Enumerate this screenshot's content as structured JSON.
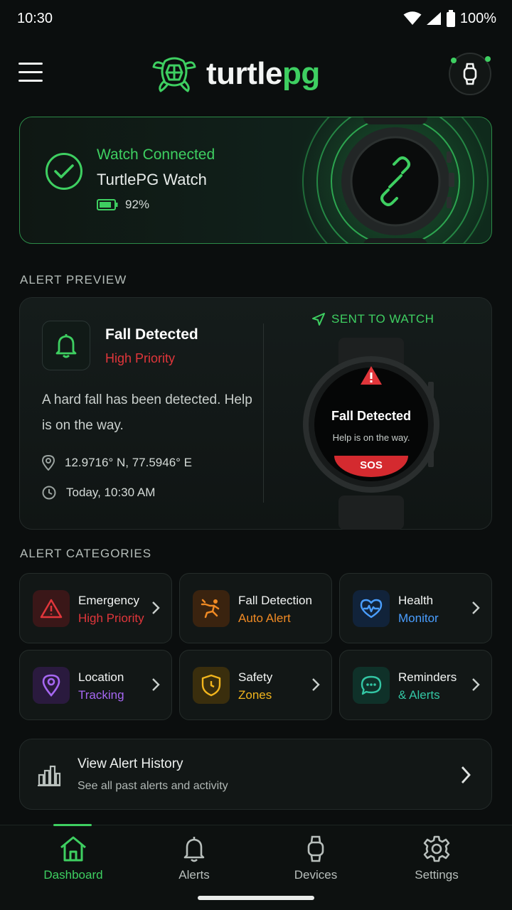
{
  "status_bar": {
    "time": "10:30",
    "battery": "100%"
  },
  "header": {
    "brand_part1": "turtle",
    "brand_part2": "pg"
  },
  "watch_connection": {
    "status": "Watch Connected",
    "device_name": "TurtlePG Watch",
    "battery": "92%"
  },
  "alert_preview": {
    "section_title": "ALERT PREVIEW",
    "title": "Fall Detected",
    "priority": "High Priority",
    "message": "A hard fall has been detected. Help is on the way.",
    "location": "12.9716° N, 77.5946° E",
    "time": "Today, 10:30 AM",
    "sent_label": "SENT TO WATCH",
    "watch_title": "Fall Detected",
    "watch_sub": "Help is on the way.",
    "watch_sos": "SOS"
  },
  "categories": {
    "section_title": "ALERT CATEGORIES",
    "items": [
      {
        "name": "Emergency",
        "sub": "High Priority",
        "color": "#e1363b",
        "icon": "warning-icon"
      },
      {
        "name": "Fall Detection",
        "sub": "Auto Alert",
        "color": "#f08a24",
        "icon": "fall-person-icon"
      },
      {
        "name": "Health",
        "sub": "Monitor",
        "color": "#4a9eff",
        "icon": "heart-pulse-icon"
      },
      {
        "name": "Location",
        "sub": "Tracking",
        "color": "#a667f2",
        "icon": "location-pin-icon"
      },
      {
        "name": "Safety",
        "sub": "Zones",
        "color": "#f2b51d",
        "icon": "shield-icon"
      },
      {
        "name": "Reminders",
        "sub": "& Alerts",
        "color": "#33c6a4",
        "icon": "chat-bubble-icon"
      }
    ]
  },
  "history": {
    "title": "View Alert History",
    "subtitle": "See all past alerts and activity"
  },
  "tabs": [
    {
      "label": "Dashboard",
      "icon": "home-icon"
    },
    {
      "label": "Alerts",
      "icon": "bell-icon"
    },
    {
      "label": "Devices",
      "icon": "watch-icon"
    },
    {
      "label": "Settings",
      "icon": "gear-icon"
    }
  ],
  "colors": {
    "accent": "#3ecf61",
    "danger": "#e1363b",
    "background": "#0b0e0e"
  }
}
